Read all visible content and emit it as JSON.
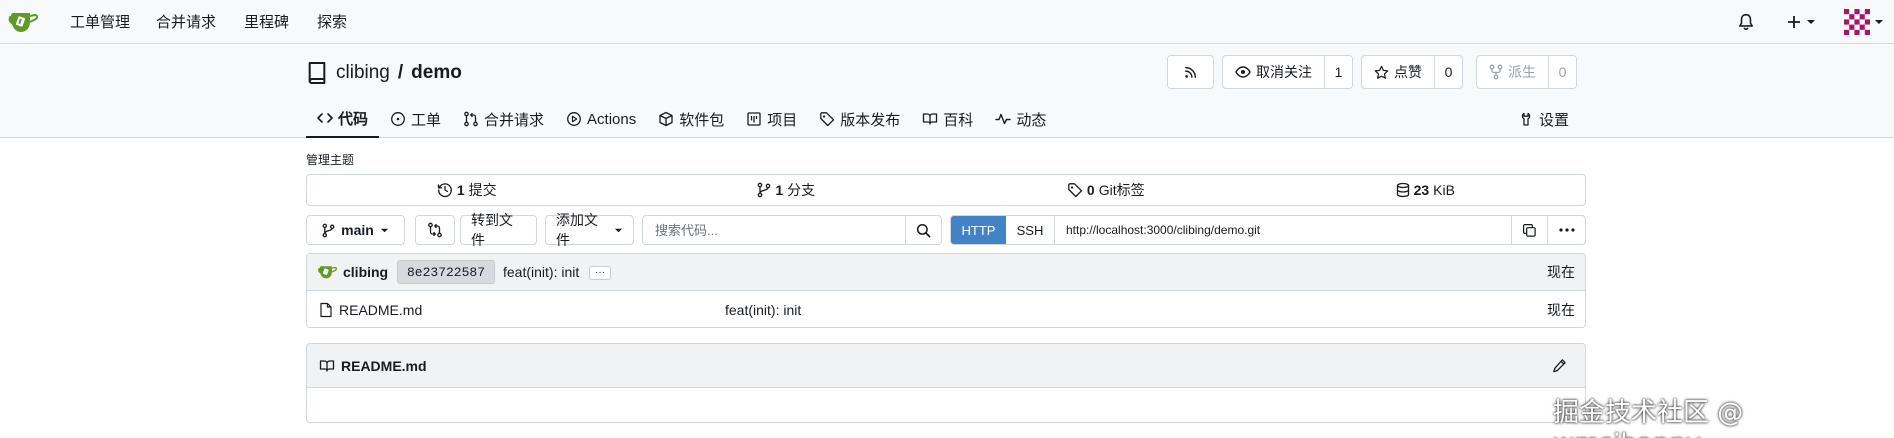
{
  "navbar": {
    "items": [
      "工单管理",
      "合并请求",
      "里程碑",
      "探索"
    ],
    "icons": [
      "gitea-logo-icon",
      "bell-icon",
      "plus-icon",
      "avatar-identicon"
    ]
  },
  "repo": {
    "owner": "clibing",
    "separator": "/",
    "name": "demo",
    "rss_icon": "rss-icon",
    "unwatch_label": "取消关注",
    "watch_count": "1",
    "star_label": "点赞",
    "star_count": "0",
    "fork_label": "派生",
    "fork_count": "0"
  },
  "tabs": [
    {
      "label": "代码",
      "icon": "code-icon",
      "active": true
    },
    {
      "label": "工单",
      "icon": "issue-icon"
    },
    {
      "label": "合并请求",
      "icon": "pull-request-icon"
    },
    {
      "label": "Actions",
      "icon": "play-icon"
    },
    {
      "label": "软件包",
      "icon": "package-icon"
    },
    {
      "label": "项目",
      "icon": "project-icon"
    },
    {
      "label": "版本发布",
      "icon": "tag-icon"
    },
    {
      "label": "百科",
      "icon": "book-icon"
    },
    {
      "label": "动态",
      "icon": "pulse-icon"
    }
  ],
  "settings_label": "设置",
  "manage_topics": "管理主题",
  "stats": {
    "commits_count": "1",
    "commits_label": "提交",
    "branches_count": "1",
    "branches_label": "分支",
    "tags_count": "0",
    "tags_label": "Git标签",
    "size_value": "23",
    "size_unit": "KiB"
  },
  "toolbar": {
    "branch": "main",
    "goto_file": "转到文件",
    "add_file": "添加文件",
    "search_placeholder": "搜索代码...",
    "clone_http": "HTTP",
    "clone_ssh": "SSH",
    "clone_url": "http://localhost:3000/clibing/demo.git"
  },
  "latest_commit": {
    "author": "clibing",
    "sha": "8e23722587",
    "message": "feat(init): init",
    "ellipsis": "···",
    "time": "现在"
  },
  "files": [
    {
      "name": "README.md",
      "commit": "feat(init): init",
      "time": "现在",
      "icon": "file-icon"
    }
  ],
  "readme": {
    "title": "README.md"
  },
  "watermark": "掘金技术社区 @ wmsjhappy",
  "colors": {
    "accent": "#4183c4",
    "header_bg": "#f8f9fb",
    "border": "#d0d7de",
    "logo_green": "#609926"
  }
}
